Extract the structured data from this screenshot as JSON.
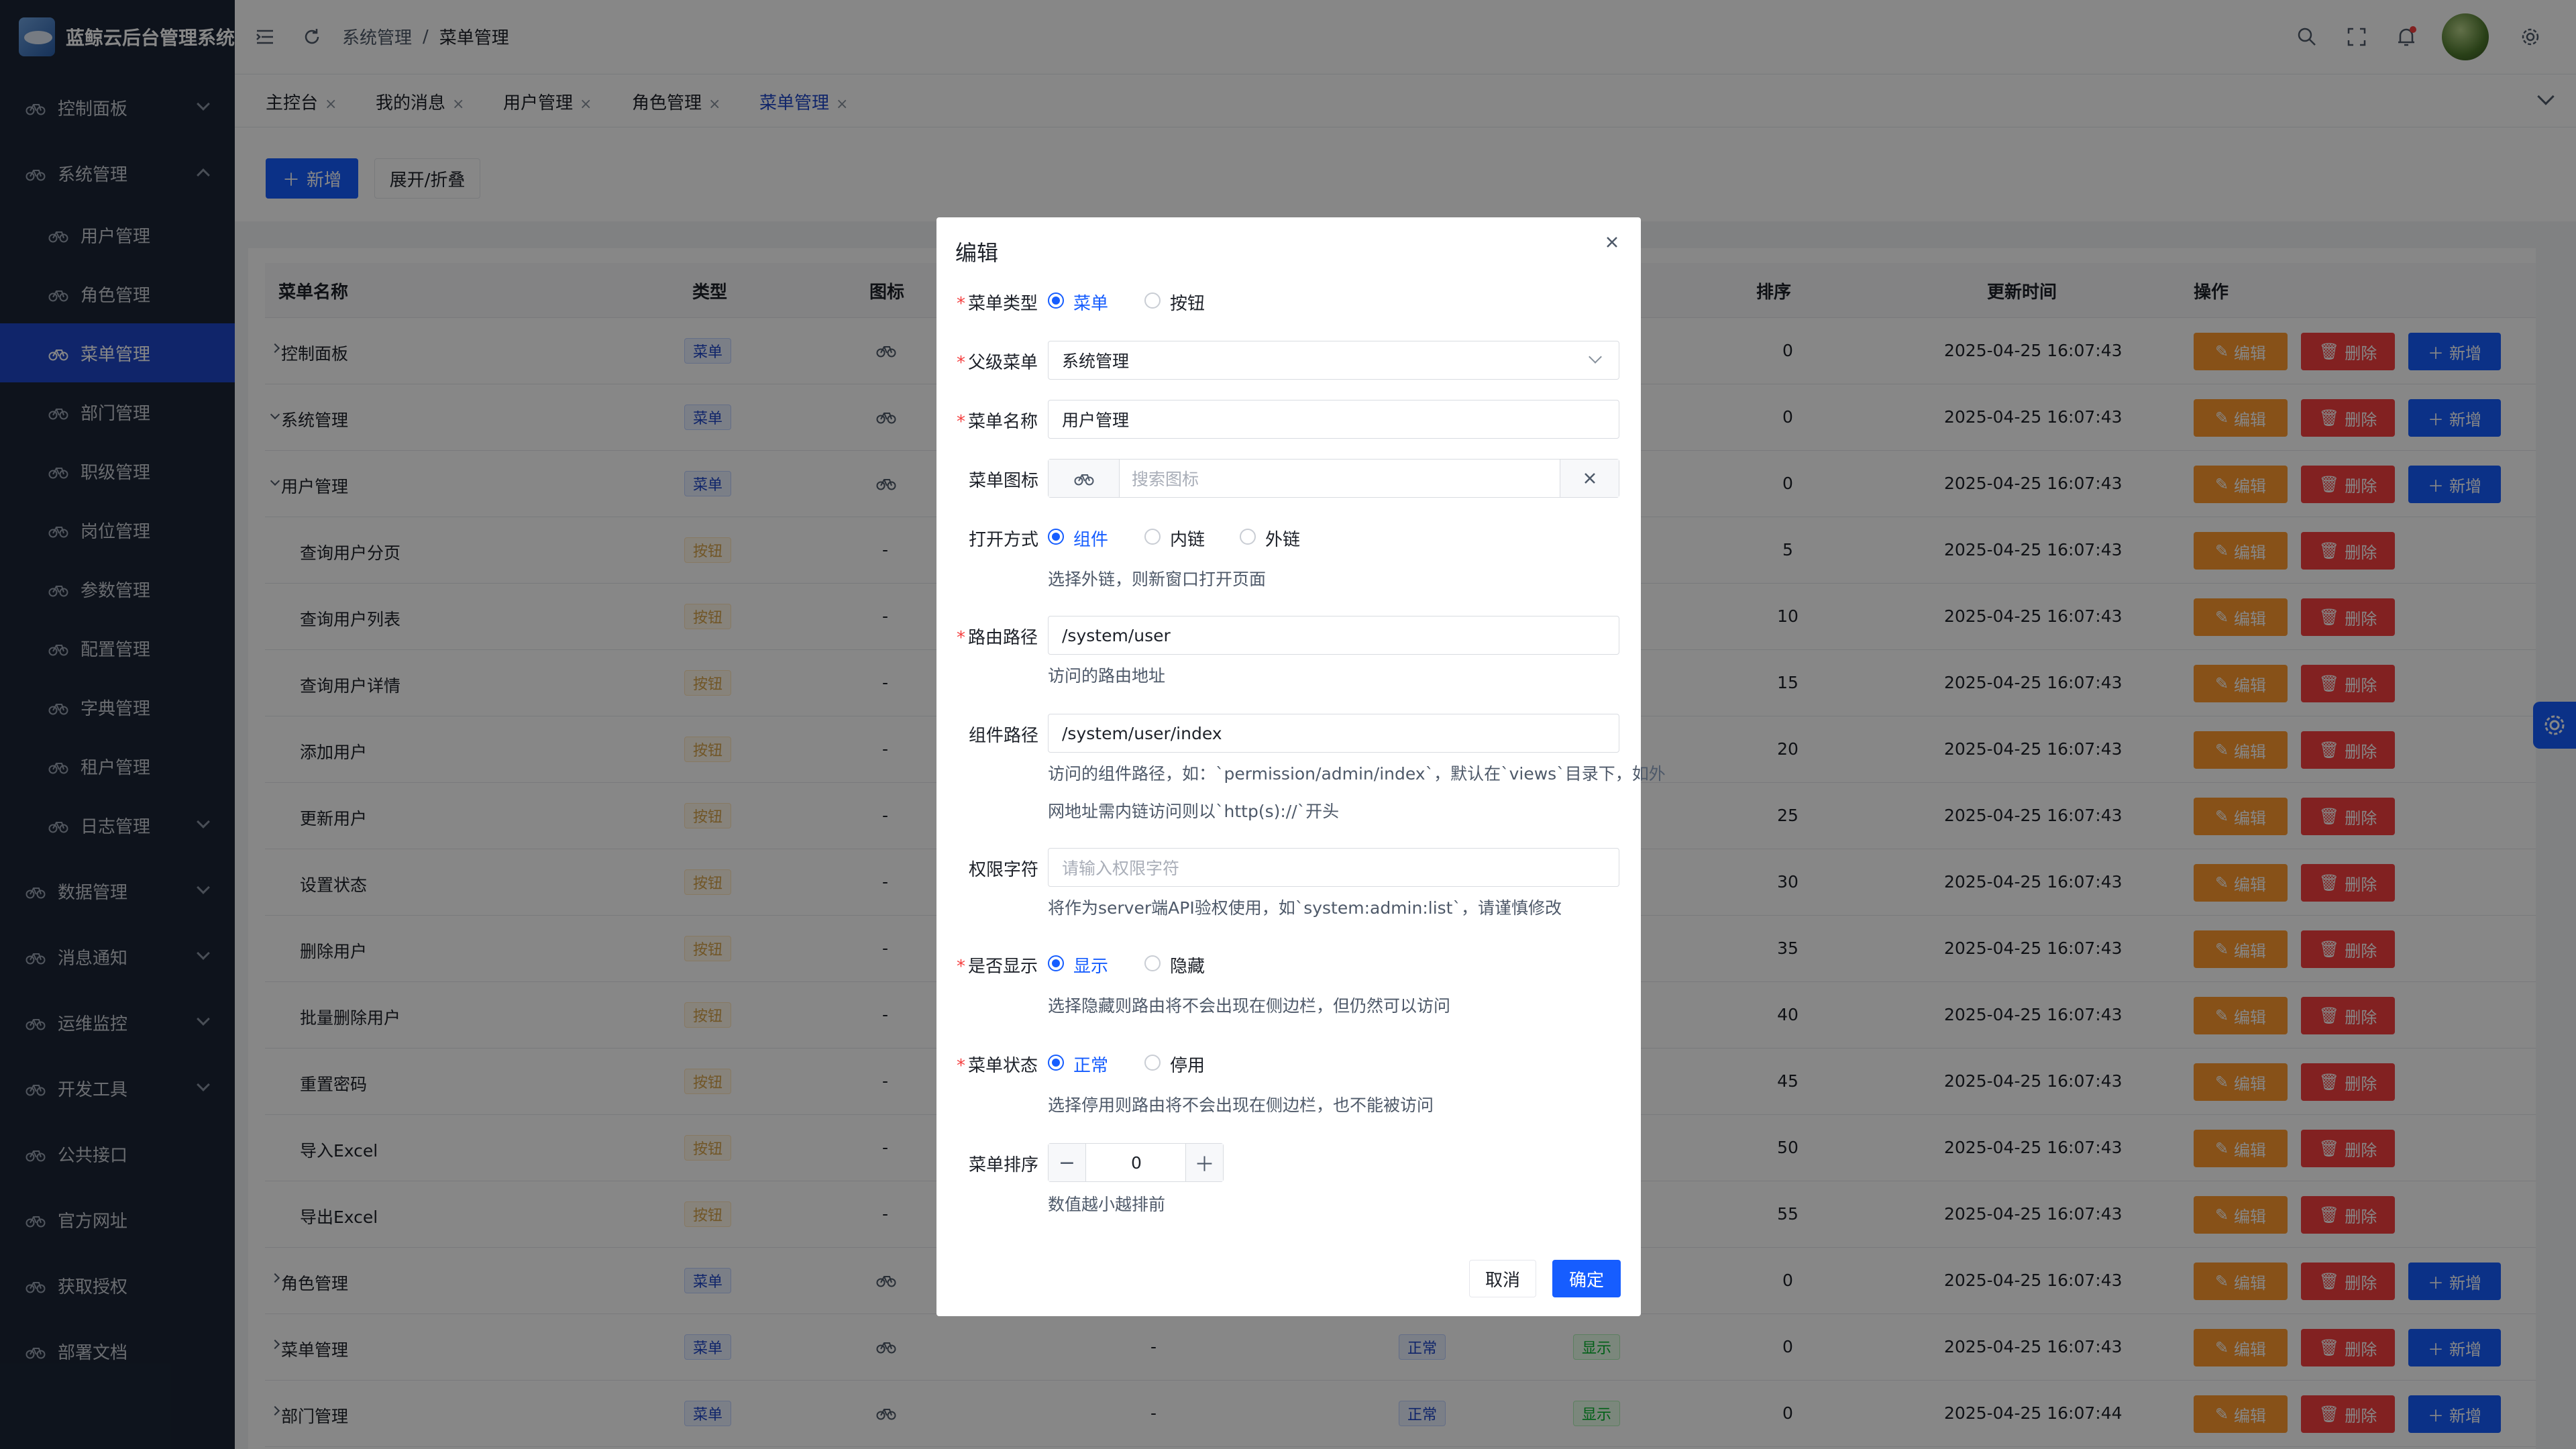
{
  "app": {
    "title": "蓝鲸云后台管理系统"
  },
  "sidebar": {
    "items": [
      {
        "label": "控制面板"
      },
      {
        "label": "系统管理"
      },
      {
        "label": "用户管理"
      },
      {
        "label": "角色管理"
      },
      {
        "label": "菜单管理"
      },
      {
        "label": "部门管理"
      },
      {
        "label": "职级管理"
      },
      {
        "label": "岗位管理"
      },
      {
        "label": "参数管理"
      },
      {
        "label": "配置管理"
      },
      {
        "label": "字典管理"
      },
      {
        "label": "租户管理"
      },
      {
        "label": "日志管理"
      },
      {
        "label": "数据管理"
      },
      {
        "label": "消息通知"
      },
      {
        "label": "运维监控"
      },
      {
        "label": "开发工具"
      },
      {
        "label": "公共接口"
      },
      {
        "label": "官方网址"
      },
      {
        "label": "获取授权"
      },
      {
        "label": "部署文档"
      }
    ]
  },
  "header": {
    "breadcrumb_root": "系统管理",
    "breadcrumb_sep": "/",
    "breadcrumb_current": "菜单管理"
  },
  "tabs": [
    {
      "label": "主控台"
    },
    {
      "label": "我的消息"
    },
    {
      "label": "用户管理"
    },
    {
      "label": "角色管理"
    },
    {
      "label": "菜单管理"
    }
  ],
  "toolbar": {
    "add_label": "新增",
    "expand_label": "展开/折叠"
  },
  "table": {
    "columns": {
      "name": "菜单名称",
      "type": "类型",
      "icon": "图标",
      "sort": "排序",
      "updated": "更新时间",
      "ops": "操作"
    },
    "rows": [
      {
        "name": "控制面板",
        "type": "菜单",
        "icon": "-",
        "sort": "0",
        "updated": "2025-04-25 16:07:43",
        "status": "",
        "visible": ""
      },
      {
        "name": "系统管理",
        "type": "菜单",
        "icon": "-",
        "sort": "0",
        "updated": "2025-04-25 16:07:43",
        "status": "",
        "visible": ""
      },
      {
        "name": "用户管理",
        "type": "菜单",
        "icon": "-",
        "sort": "0",
        "updated": "2025-04-25 16:07:43",
        "status": "",
        "visible": ""
      },
      {
        "name": "查询用户分页",
        "type": "按钮",
        "icon": "-",
        "sort": "5",
        "updated": "2025-04-25 16:07:43",
        "status": "",
        "visible": ""
      },
      {
        "name": "查询用户列表",
        "type": "按钮",
        "icon": "-",
        "sort": "10",
        "updated": "2025-04-25 16:07:43",
        "status": "",
        "visible": ""
      },
      {
        "name": "查询用户详情",
        "type": "按钮",
        "icon": "-",
        "sort": "15",
        "updated": "2025-04-25 16:07:43",
        "status": "",
        "visible": ""
      },
      {
        "name": "添加用户",
        "type": "按钮",
        "icon": "-",
        "sort": "20",
        "updated": "2025-04-25 16:07:43",
        "status": "",
        "visible": ""
      },
      {
        "name": "更新用户",
        "type": "按钮",
        "icon": "-",
        "sort": "25",
        "updated": "2025-04-25 16:07:43",
        "status": "",
        "visible": ""
      },
      {
        "name": "设置状态",
        "type": "按钮",
        "icon": "-",
        "sort": "30",
        "updated": "2025-04-25 16:07:43",
        "status": "",
        "visible": ""
      },
      {
        "name": "删除用户",
        "type": "按钮",
        "icon": "-",
        "sort": "35",
        "updated": "2025-04-25 16:07:43",
        "status": "",
        "visible": ""
      },
      {
        "name": "批量删除用户",
        "type": "按钮",
        "icon": "-",
        "sort": "40",
        "updated": "2025-04-25 16:07:43",
        "status": "",
        "visible": ""
      },
      {
        "name": "重置密码",
        "type": "按钮",
        "icon": "-",
        "sort": "45",
        "updated": "2025-04-25 16:07:43",
        "status": "",
        "visible": ""
      },
      {
        "name": "导入Excel",
        "type": "按钮",
        "icon": "-",
        "sort": "50",
        "updated": "2025-04-25 16:07:43",
        "status": "",
        "visible": ""
      },
      {
        "name": "导出Excel",
        "type": "按钮",
        "icon": "-",
        "sort": "55",
        "updated": "2025-04-25 16:07:43",
        "status": "",
        "visible": ""
      },
      {
        "name": "角色管理",
        "type": "菜单",
        "icon": "-",
        "sort": "0",
        "updated": "2025-04-25 16:07:43",
        "status": "",
        "visible": ""
      },
      {
        "name": "菜单管理",
        "type": "菜单",
        "icon": "-",
        "sort": "0",
        "updated": "2025-04-25 16:07:43",
        "status": "正常",
        "visible": "显示"
      },
      {
        "name": "部门管理",
        "type": "菜单",
        "icon": "-",
        "sort": "0",
        "updated": "2025-04-25 16:07:44",
        "status": "正常",
        "visible": "显示"
      }
    ],
    "actions": {
      "edit": "编辑",
      "delete": "删除",
      "add": "新增"
    }
  },
  "modal": {
    "title": "编辑",
    "menu_type": {
      "label": "菜单类型",
      "opt1": "菜单",
      "opt2": "按钮"
    },
    "parent": {
      "label": "父级菜单",
      "value": "系统管理"
    },
    "name": {
      "label": "菜单名称",
      "value": "用户管理"
    },
    "icon": {
      "label": "菜单图标",
      "placeholder": "搜索图标"
    },
    "open_mode": {
      "label": "打开方式",
      "opt1": "组件",
      "opt2": "内链",
      "opt3": "外链",
      "help": "选择外链，则新窗口打开页面"
    },
    "route": {
      "label": "路由路径",
      "value": "/system/user",
      "help": "访问的路由地址"
    },
    "component": {
      "label": "组件路径",
      "value": "/system/user/index",
      "help1": "访问的组件路径，如：`permission/admin/index`，默认在`views`目录下，如外",
      "help2": "网地址需内链访问则以`http(s)://`开头"
    },
    "perm": {
      "label": "权限字符",
      "placeholder": "请输入权限字符",
      "help": "将作为server端API验权使用，如`system:admin:list`，请谨慎修改"
    },
    "visible": {
      "label": "是否显示",
      "opt1": "显示",
      "opt2": "隐藏",
      "help": "选择隐藏则路由将不会出现在侧边栏，但仍然可以访问"
    },
    "status": {
      "label": "菜单状态",
      "opt1": "正常",
      "opt2": "停用",
      "help": "选择停用则路由将不会出现在侧边栏，也不能被访问"
    },
    "sort": {
      "label": "菜单排序",
      "value": "0",
      "help": "数值越小越排前"
    },
    "cancel": "取消",
    "ok": "确定"
  },
  "colors": {
    "primary": "#165dff",
    "sidebar": "#1b2536",
    "warning": "#ff9a2e",
    "danger": "#f53f3f"
  }
}
